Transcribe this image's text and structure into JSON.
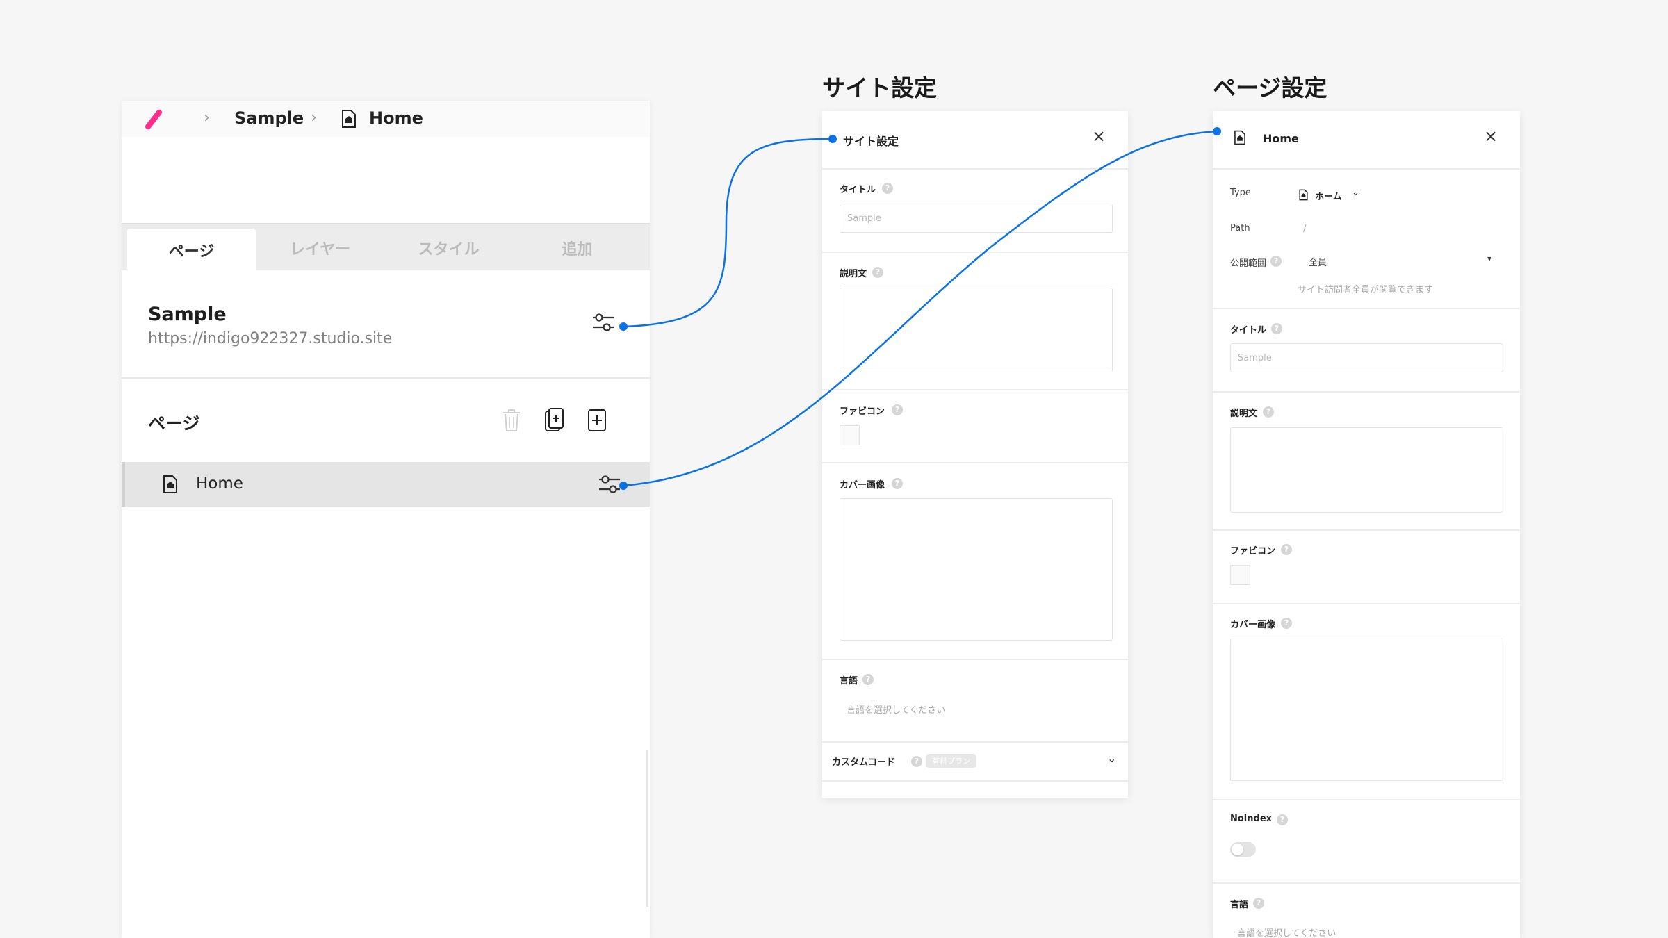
{
  "breadcrumb": {
    "project": "Sample",
    "page": "Home"
  },
  "tabs": [
    "ページ",
    "レイヤー",
    "スタイル",
    "追加"
  ],
  "site": {
    "name": "Sample",
    "url": "https://indigo922327.studio.site"
  },
  "pages_section": {
    "label": "ページ",
    "items": [
      {
        "label": "Home"
      }
    ]
  },
  "site_settings": {
    "caption": "サイト設定",
    "header_title": "サイト設定",
    "title_label": "タイトル",
    "title_placeholder": "Sample",
    "description_label": "説明文",
    "favicon_label": "ファビコン",
    "cover_label": "カバー画像",
    "language_label": "言語",
    "language_placeholder": "言語を選択してください",
    "custom_code_label": "カスタムコード",
    "paid_badge": "有料プラン"
  },
  "page_settings": {
    "caption": "ページ設定",
    "header_title": "Home",
    "type_label": "Type",
    "type_value": "ホーム",
    "path_label": "Path",
    "path_value": "/",
    "visibility_label": "公開範囲",
    "visibility_value": "全員",
    "visibility_hint": "サイト訪問者全員が閲覧できます",
    "title_label": "タイトル",
    "title_placeholder": "Sample",
    "description_label": "説明文",
    "favicon_label": "ファビコン",
    "cover_label": "カバー画像",
    "noindex_label": "Noindex",
    "noindex_enabled": false,
    "language_label": "言語",
    "language_placeholder": "言語を選択してください"
  },
  "colors": {
    "accent": "#0a72e6",
    "logo": "#ff2c8a"
  },
  "icons": [
    "sliders-icon",
    "trash-icon",
    "duplicate-page-icon",
    "add-page-icon",
    "page-home-icon",
    "close-icon",
    "chevron-down-icon",
    "help-icon"
  ]
}
